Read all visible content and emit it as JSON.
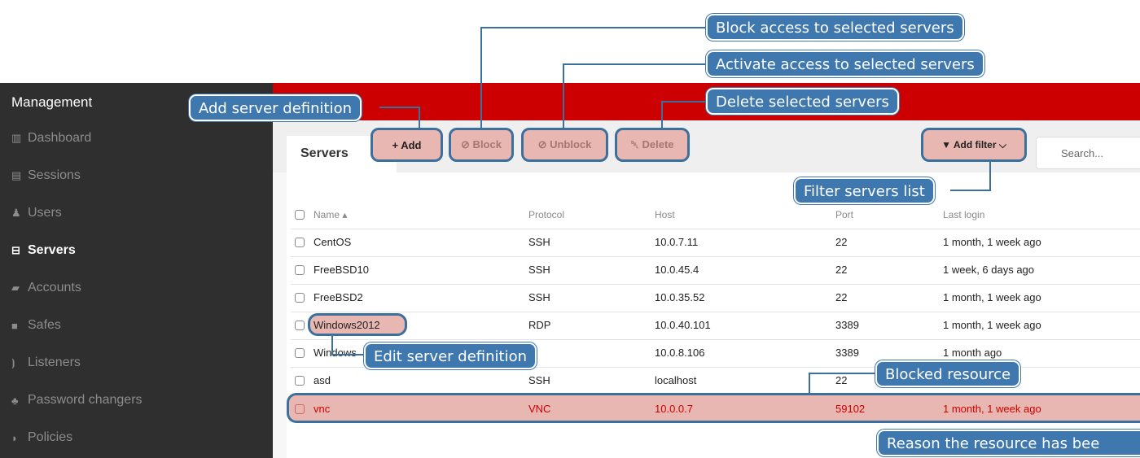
{
  "sidebar": {
    "title": "Management",
    "items": [
      {
        "label": "Dashboard",
        "icon": "bar-chart-icon",
        "glyph": "▥"
      },
      {
        "label": "Sessions",
        "icon": "film-icon",
        "glyph": "▤"
      },
      {
        "label": "Users",
        "icon": "users-icon",
        "glyph": "♟"
      },
      {
        "label": "Servers",
        "icon": "hdd-icon",
        "glyph": "⊟",
        "active": true
      },
      {
        "label": "Accounts",
        "icon": "book-icon",
        "glyph": "▰"
      },
      {
        "label": "Safes",
        "icon": "safe-icon",
        "glyph": "■"
      },
      {
        "label": "Listeners",
        "icon": "rss-icon",
        "glyph": "⦘"
      },
      {
        "label": "Password changers",
        "icon": "sitemap-icon",
        "glyph": "♣"
      },
      {
        "label": "Policies",
        "icon": "shield-icon",
        "glyph": "◗"
      }
    ]
  },
  "tab": {
    "label": "Servers"
  },
  "toolbar": {
    "add_label": "+ Add",
    "block_label": "⊘ Block",
    "unblock_label": "⊘ Unblock",
    "delete_label": "␡ Delete",
    "filter_label": "▼ Add filter ⌵",
    "search_placeholder": "Search..."
  },
  "table": {
    "headers": {
      "name": "Name ▴",
      "protocol": "Protocol",
      "host": "Host",
      "port": "Port",
      "last_login": "Last login"
    },
    "rows": [
      {
        "name": "CentOS",
        "protocol": "SSH",
        "host": "10.0.7.11",
        "port": "22",
        "last_login": "1 month, 1 week ago"
      },
      {
        "name": "FreeBSD10",
        "protocol": "SSH",
        "host": "10.0.45.4",
        "port": "22",
        "last_login": "1 week, 6 days ago"
      },
      {
        "name": "FreeBSD2",
        "protocol": "SSH",
        "host": "10.0.35.52",
        "port": "22",
        "last_login": "1 month, 1 week ago"
      },
      {
        "name": "Windows2012",
        "protocol": "RDP",
        "host": "10.0.40.101",
        "port": "3389",
        "last_login": "1 month, 1 week ago"
      },
      {
        "name": "Windows",
        "protocol": "",
        "host": "10.0.8.106",
        "port": "3389",
        "last_login": "1 month ago"
      },
      {
        "name": "asd",
        "protocol": "SSH",
        "host": "localhost",
        "port": "22",
        "last_login": ""
      },
      {
        "name": "vnc",
        "protocol": "VNC",
        "host": "10.0.0.7",
        "port": "59102",
        "last_login": "1 month, 1 week ago",
        "blocked": true
      }
    ]
  },
  "callouts": {
    "block": "Block access to selected servers",
    "activate": "Activate access to selected servers",
    "delete": "Delete selected servers",
    "add": "Add server definition",
    "filter": "Filter servers list",
    "edit": "Edit server definition",
    "blocked": "Blocked resource",
    "reason": "Reason the resource has bee"
  },
  "colors": {
    "brand_red": "#cc0000",
    "callout_blue": "#3f78ae",
    "highlight_pink": "#e8b7b1",
    "sidebar_bg": "#2f2f2f"
  }
}
